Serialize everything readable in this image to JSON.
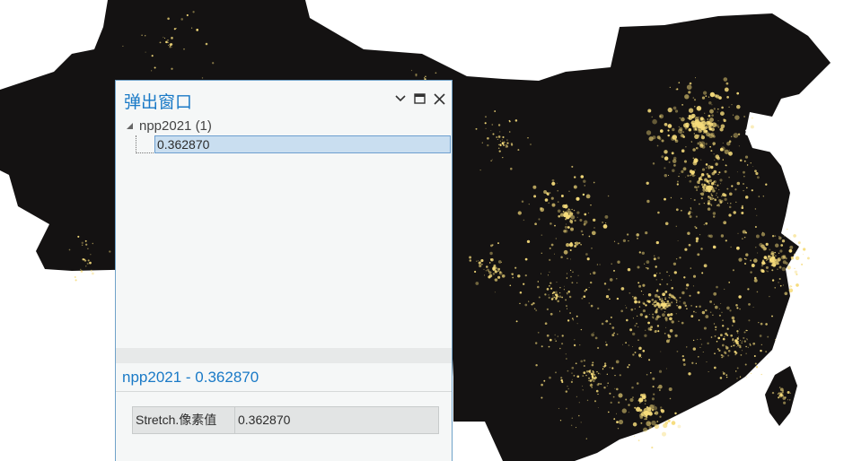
{
  "popup": {
    "title": "弹出窗口",
    "layer_label": "npp2021 (1)",
    "selected_value": "0.362870",
    "details_title": "npp2021 - 0.362870",
    "attributes": [
      {
        "key": "Stretch.像素值",
        "value": "0.362870"
      }
    ]
  },
  "icons": {
    "menu": "chevron-down-icon",
    "maximize": "maximize-icon",
    "close": "close-icon",
    "expander": "collapse-triangle-icon"
  },
  "colors": {
    "map_background": "#141212",
    "city_lights": "#f6dc7b",
    "accent_blue": "#1a7ac7",
    "selection": "#c9def0"
  }
}
